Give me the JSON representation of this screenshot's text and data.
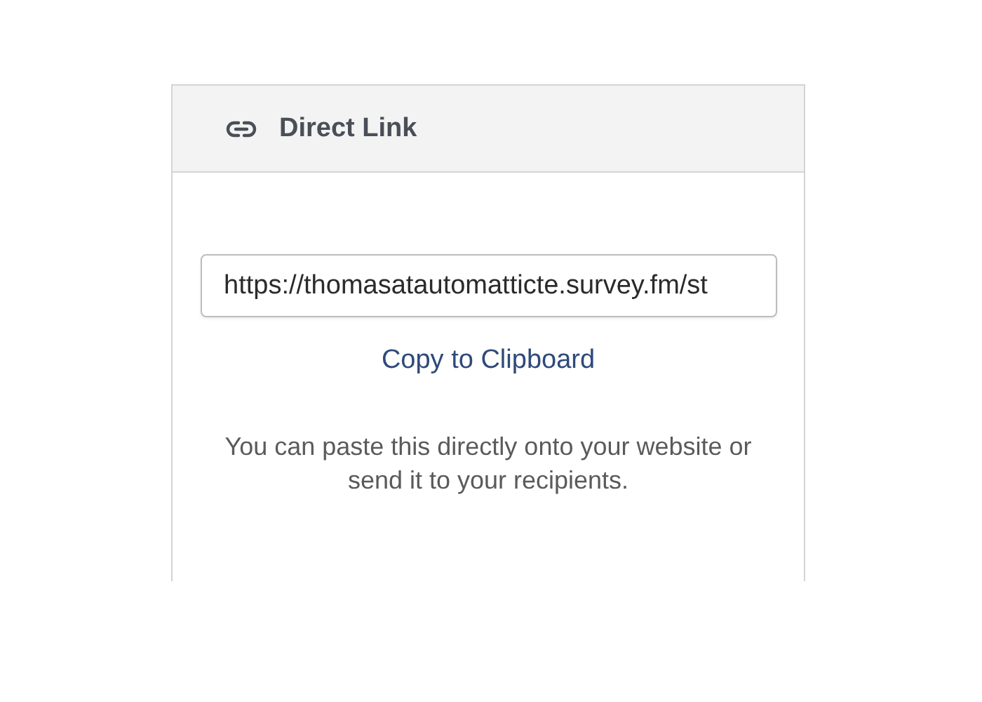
{
  "panel": {
    "title": "Direct Link"
  },
  "link_field": {
    "value": "https://thomasatautomatticte.survey.fm/st"
  },
  "copy_link": "Copy to Clipboard",
  "description": "You can paste this directly onto your website or send it to your recipients."
}
